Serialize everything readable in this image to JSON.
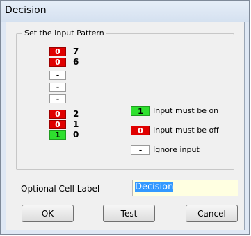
{
  "window": {
    "title": "Decision"
  },
  "group": {
    "label": "Set the Input Pattern"
  },
  "bits": [
    {
      "state": "off",
      "text": "0",
      "index": "7"
    },
    {
      "state": "off",
      "text": "0",
      "index": "6"
    },
    {
      "state": "ignore",
      "text": "-",
      "index": ""
    },
    {
      "state": "ignore",
      "text": "-",
      "index": ""
    },
    {
      "state": "ignore",
      "text": "-",
      "index": ""
    },
    {
      "state": "off",
      "text": "0",
      "index": "2"
    },
    {
      "state": "off",
      "text": "0",
      "index": "1"
    },
    {
      "state": "on",
      "text": "1",
      "index": "0"
    }
  ],
  "legend": {
    "on": {
      "swatch": "1",
      "label": "Input must be on",
      "color": "#2ee02e"
    },
    "off": {
      "swatch": "0",
      "label": "Input must be off",
      "color": "#e00000"
    },
    "ignore": {
      "swatch": "-",
      "label": "Ignore input"
    }
  },
  "cell_label": {
    "label": "Optional Cell Label",
    "value": "Decision"
  },
  "buttons": {
    "ok": "OK",
    "test": "Test",
    "cancel": "Cancel"
  }
}
